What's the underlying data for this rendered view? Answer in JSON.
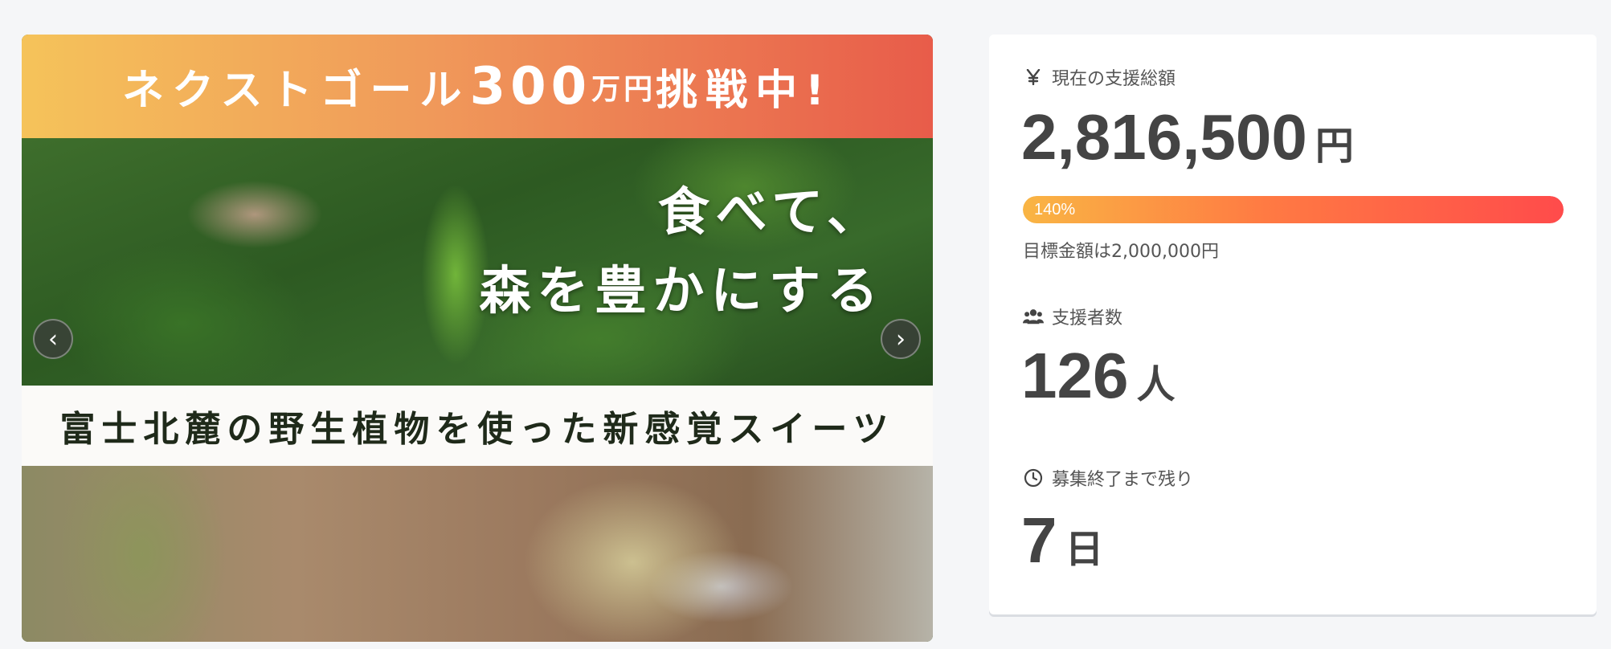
{
  "hero": {
    "banner": {
      "prefix": "ネクストゴール",
      "amount": "300",
      "unit": "万円",
      "suffix": "挑戦中!"
    },
    "tagline": {
      "line1": "食べて、",
      "line2": "森を豊かにする"
    },
    "subtitle": "富士北麓の野生植物を使った新感覚スイーツ",
    "prev_arrow": "‹",
    "next_arrow": "›"
  },
  "stats": {
    "total": {
      "label": "現在の支援総額",
      "icon": "yen-icon",
      "value": "2,816,500",
      "unit": "円"
    },
    "progress": {
      "percent_label": "140%",
      "fill_percent": 100,
      "colors": [
        "#f9b544",
        "#ff7a43",
        "#ff4b4b"
      ]
    },
    "goal_text": "目標金額は2,000,000円",
    "supporters": {
      "label": "支援者数",
      "icon": "people-icon",
      "value": "126",
      "unit": "人"
    },
    "remaining": {
      "label": "募集終了まで残り",
      "icon": "clock-icon",
      "value": "7",
      "unit": "日"
    }
  }
}
